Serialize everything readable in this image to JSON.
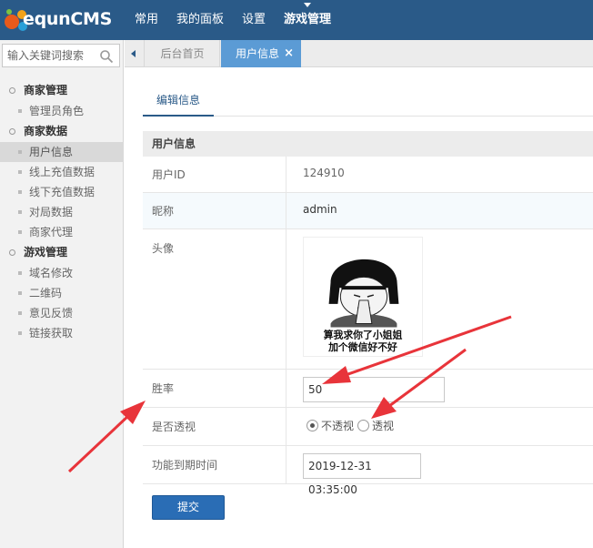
{
  "app": {
    "logo_text": "equnCMS"
  },
  "topnav": {
    "items": [
      "常用",
      "我的面板",
      "设置",
      "游戏管理"
    ],
    "active": "游戏管理"
  },
  "search": {
    "placeholder": "输入关键词搜索"
  },
  "sidebar": {
    "groups": [
      {
        "title": "商家管理",
        "items": [
          "管理员角色"
        ]
      },
      {
        "title": "商家数据",
        "items": [
          "用户信息",
          "线上充值数据",
          "线下充值数据",
          "对局数据",
          "商家代理"
        ]
      },
      {
        "title": "游戏管理",
        "items": [
          "域名修改",
          "二维码",
          "意见反馈",
          "链接获取"
        ]
      }
    ],
    "active_item": "用户信息"
  },
  "tabs": {
    "home": "后台首页",
    "active": "用户信息",
    "close": "×"
  },
  "content": {
    "subtab": "编辑信息",
    "section_title": "用户信息",
    "fields": {
      "user_id": {
        "label": "用户ID",
        "value": "124910"
      },
      "nickname": {
        "label": "昵称",
        "value": "admin"
      },
      "avatar": {
        "label": "头像",
        "caption_line1": "算我求你了小姐姐",
        "caption_line2": "加个微信好不好"
      },
      "win_rate": {
        "label": "胜率",
        "value": "50"
      },
      "transparent": {
        "label": "是否透视",
        "options": [
          "不透视",
          "透视"
        ],
        "selected": "不透视"
      },
      "expire": {
        "label": "功能到期时间",
        "value": "2019-12-31 03:35:00"
      }
    },
    "submit_label": "提交"
  },
  "colors": {
    "topbar": "#2a5a88",
    "tab_active": "#5b9bd5",
    "button": "#2a6db5",
    "arrow": "#e8343a"
  }
}
